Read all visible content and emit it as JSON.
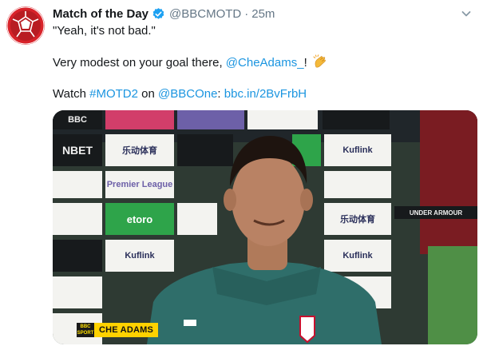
{
  "tweet": {
    "display_name": "Match of the Day",
    "handle": "@BBCMOTD",
    "separator": "·",
    "time": "25m",
    "line1": "\"Yeah, it's not bad.\"",
    "line2_prefix": "Very modest on your goal there, ",
    "mention": "@CheAdams_",
    "line2_suffix": "! ",
    "line3_prefix": "Watch ",
    "hashtag": "#MOTD2",
    "line3_mid": " on ",
    "channel": "@BBCOne",
    "line3_colon": ": ",
    "url": "bbc.in/2BvFrbH"
  },
  "media": {
    "caption_name": "CHE ADAMS",
    "caption_logo": "BBC SPORT",
    "boards": [
      "NBET",
      "乐动体育",
      "Kuflink",
      "Premier League",
      "etoro",
      "Kuflink",
      "乐动体育",
      "Kuflink",
      "UNDER ARMOUR"
    ]
  },
  "icons": {
    "avatar": "motd-logo-icon",
    "verified": "verified-badge-icon",
    "more": "chevron-down-icon",
    "emoji": "clapping-hands-icon"
  },
  "colors": {
    "link": "#1b95e0",
    "verified": "#1da1f2",
    "avatar_red": "#d8232a",
    "secondary_text": "#657786"
  }
}
